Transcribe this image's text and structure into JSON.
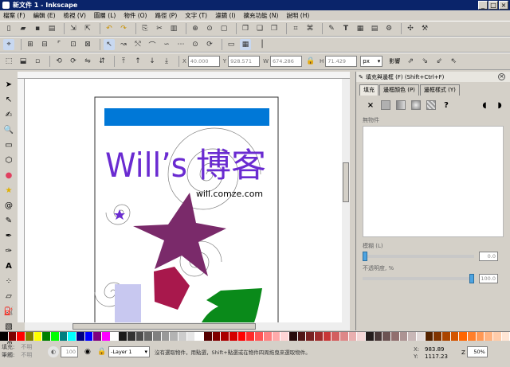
{
  "window": {
    "title": "新文件 1 - Inkscape",
    "min": "_",
    "max": "□",
    "close": "×"
  },
  "menu": [
    "檔案 (F)",
    "編輯 (E)",
    "檢視 (V)",
    "圖層 (L)",
    "物件 (O)",
    "路徑 (P)",
    "文字 (T)",
    "濾鏡 (I)",
    "擴充功能 (N)",
    "說明 (H)"
  ],
  "coords": {
    "x_label": "X",
    "x": "40.000",
    "y_label": "Y",
    "y": "928.571",
    "w_label": "W",
    "w": "674.286",
    "h_label": "H",
    "h": "71.429",
    "unit": "px",
    "affect_label": "影響"
  },
  "document": {
    "title_latin": "Will’s",
    "title_cjk": "博客",
    "url": "will.comze.com",
    "colors": {
      "bar": "#0078d7",
      "title": "#6a2bd1",
      "star": "#7a2a6a",
      "pentagon": "#a8184c",
      "shape_green": "#0a8a1a",
      "rect_lavender": "#c8c8f0"
    }
  },
  "panel": {
    "title": "填充與邊框 (F) (Shift+Ctrl+F)",
    "tabs": [
      "填充",
      "邊框顏色 (P)",
      "邊框樣式 (Y)"
    ],
    "paint_none": "×",
    "paint_unknown": "?",
    "no_object_label": "無物件",
    "blur_label": "模糊 (L)",
    "blur_value": "0.0",
    "opacity_label": "不透明度, %",
    "opacity_value": "100.0"
  },
  "palette": [
    "#000000",
    "#800000",
    "#ff0000",
    "#808000",
    "#ffff00",
    "#008000",
    "#00ff00",
    "#008080",
    "#00ffff",
    "#000080",
    "#0000ff",
    "#800080",
    "#ff00ff",
    "#ffffff",
    "#1a1a1a",
    "#333333",
    "#4d4d4d",
    "#666666",
    "#808080",
    "#999999",
    "#b3b3b3",
    "#cccccc",
    "#e6e6e6",
    "#ffffff",
    "#550000",
    "#800000",
    "#aa0000",
    "#d40000",
    "#ff0000",
    "#ff2a2a",
    "#ff5555",
    "#ff8080",
    "#ffaaaa",
    "#ffd5d5",
    "#280b0b",
    "#501616",
    "#782121",
    "#a02c2c",
    "#c83737",
    "#d35f5f",
    "#de8787",
    "#e9afaf",
    "#f4d7d7",
    "#241c1c",
    "#483737",
    "#6c5353",
    "#916f6f",
    "#ac9393",
    "#c8b7b7",
    "#e3dbdb",
    "#552200",
    "#803300",
    "#aa4400",
    "#d45500",
    "#ff6600",
    "#ff7f2a",
    "#ff9955",
    "#ffb380",
    "#ffccaa",
    "#ffe6d5"
  ],
  "status": {
    "fill_label": "填充:",
    "fill_value": "不明",
    "stroke_label": "筆觸:",
    "stroke_value": "不明",
    "opacity_value": "100",
    "layer": "-Layer 1",
    "message": "沒有選取物件，用點選，Shift+點選或在物件四周拖曳來選取物件。",
    "x_label": "X:",
    "x": "983.89",
    "y_label": "Y:",
    "y": "1117.23",
    "zoom_label": "Z",
    "zoom": "50%"
  },
  "icons": [
    "selector-icon",
    "node-icon",
    "tweak-icon",
    "zoom-icon",
    "rect-icon",
    "3dbox-icon",
    "ellipse-icon",
    "star-icon",
    "spiral-icon",
    "pencil-icon",
    "pen-icon",
    "calligraphy-icon",
    "text-icon",
    "spray-icon",
    "eraser-icon",
    "bucket-icon",
    "gradient-icon",
    "dropper-icon"
  ]
}
